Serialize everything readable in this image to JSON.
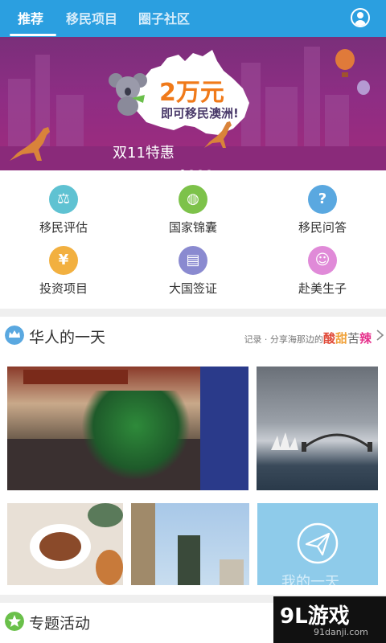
{
  "tabs": [
    {
      "label": "推荐"
    },
    {
      "label": "移民项目"
    },
    {
      "label": "圈子社区"
    }
  ],
  "banner": {
    "headline": "2万元",
    "subline": "即可移民澳洲!",
    "bottom_text": "双11特惠"
  },
  "menu": [
    {
      "label": "移民评估",
      "icon": "scale-icon",
      "color": "#5fc2d2"
    },
    {
      "label": "国家锦囊",
      "icon": "globe-icon",
      "color": "#7dc24a"
    },
    {
      "label": "移民问答",
      "icon": "question-icon",
      "color": "#5aa8e0"
    },
    {
      "label": "投资项目",
      "icon": "yen-coin-icon",
      "color": "#f2b040"
    },
    {
      "label": "大国签证",
      "icon": "passport-icon",
      "color": "#8a8ad0"
    },
    {
      "label": "赴美生子",
      "icon": "baby-icon",
      "color": "#e08ad8"
    }
  ],
  "section_one": {
    "title": "华人的一天",
    "tagline_prefix": "记录 · 分享海那边的",
    "tag1": "酸",
    "tag2": "甜",
    "tag3": "苦",
    "tag4": "辣",
    "card_text": "我的一天"
  },
  "section_two": {
    "title": "专题活动"
  },
  "watermark": {
    "logo": "9L游戏",
    "url": "91danji.com"
  }
}
